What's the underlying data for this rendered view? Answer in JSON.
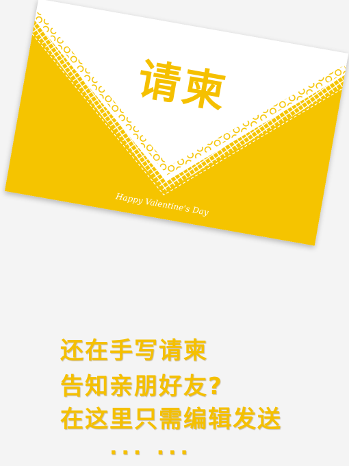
{
  "card": {
    "title": "请柬",
    "signature": "Happy Valentine's Day",
    "colors": {
      "accent": "#f5c400",
      "paper": "#ffffff",
      "title": "#f5c000"
    }
  },
  "lines": [
    "还在手写请柬",
    "告知亲朋好友?",
    "在这里只需编辑发送"
  ],
  "ellipsis": "... ..."
}
